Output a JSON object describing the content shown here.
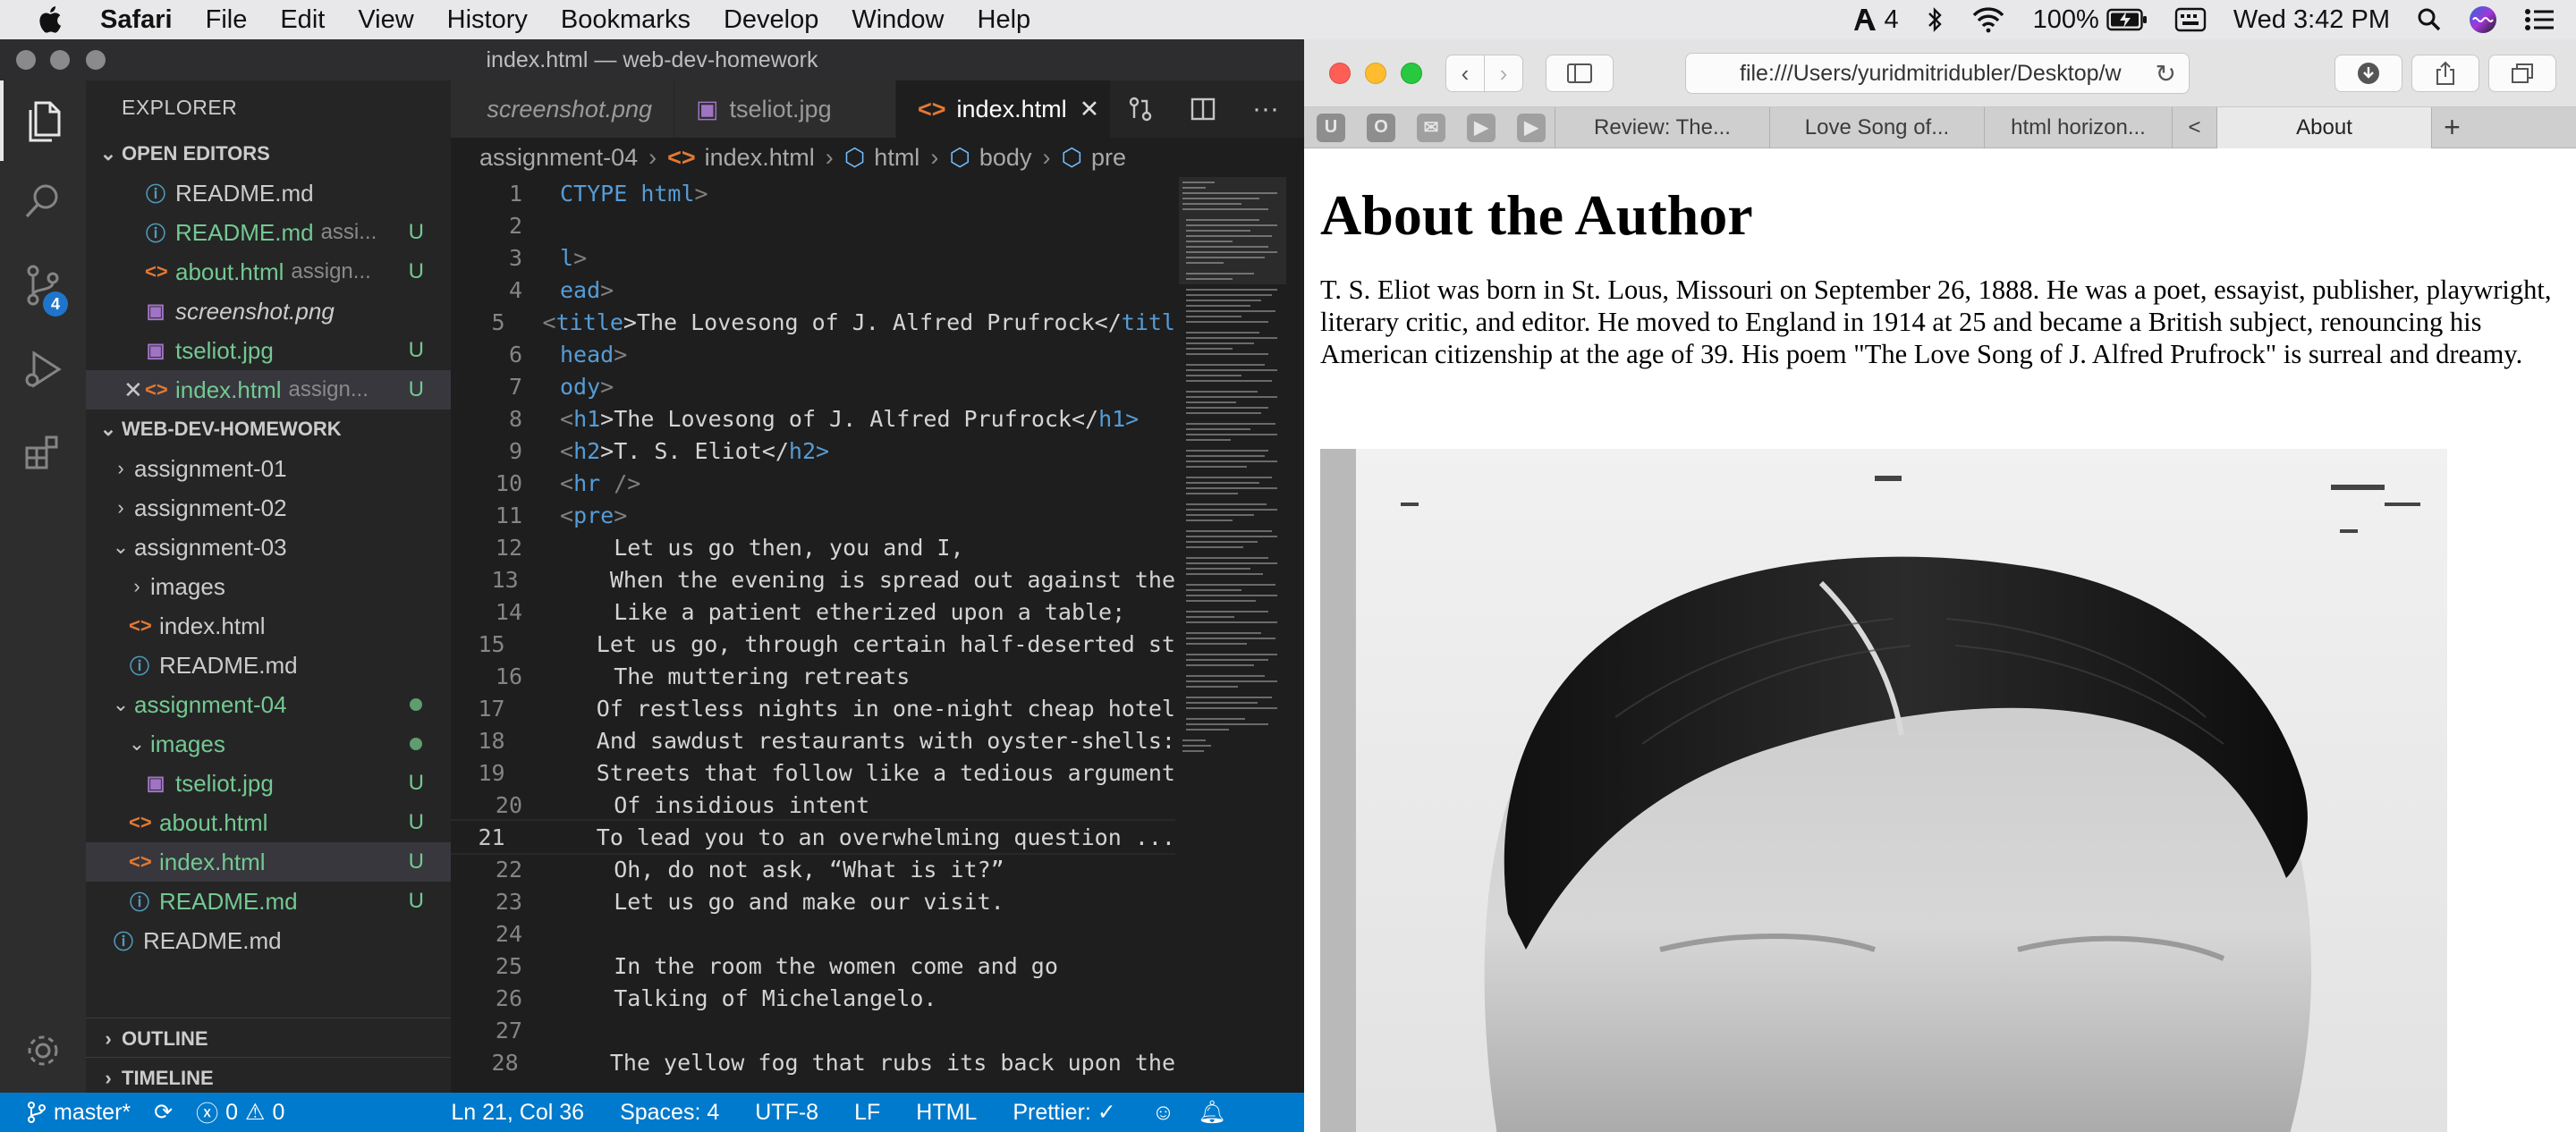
{
  "menubar": {
    "app": "Safari",
    "items": [
      "File",
      "Edit",
      "View",
      "History",
      "Bookmarks",
      "Develop",
      "Window",
      "Help"
    ],
    "adobe_count": "4",
    "battery": "100%",
    "clock": "Wed 3:42 PM"
  },
  "vscode": {
    "title": "index.html — web-dev-homework",
    "scm_badge": "4",
    "explorer": {
      "header": "EXPLORER",
      "open_editors_label": "OPEN EDITORS",
      "open_editors": [
        {
          "name": "README.md",
          "hint": "",
          "decoration": ""
        },
        {
          "name": "README.md",
          "hint": "assi...",
          "decoration": "U"
        },
        {
          "name": "about.html",
          "hint": "assign...",
          "decoration": "U"
        },
        {
          "name": "screenshot.png",
          "hint": "",
          "decoration": ""
        },
        {
          "name": "tseliot.jpg",
          "hint": "",
          "decoration": "U"
        },
        {
          "name": "index.html",
          "hint": "assign...",
          "decoration": "U"
        }
      ],
      "workspace_label": "WEB-DEV-HOMEWORK",
      "tree": {
        "a1": "assignment-01",
        "a2": "assignment-02",
        "a3": "assignment-03",
        "a3_images": "images",
        "a3_index": "index.html",
        "a3_readme": "README.md",
        "a4": "assignment-04",
        "a4_images": "images",
        "a4_tseliot": "tseliot.jpg",
        "a4_about": "about.html",
        "a4_index": "index.html",
        "a4_readme": "README.md",
        "root_readme": "README.md",
        "u": "U"
      },
      "outline_label": "OUTLINE",
      "timeline_label": "TIMELINE"
    },
    "tabs": [
      "screenshot.png",
      "tseliot.jpg",
      "index.html"
    ],
    "breadcrumbs": [
      "assignment-04",
      "index.html",
      "html",
      "body",
      "pre"
    ],
    "code_lines": [
      {
        "n": "1",
        "a": "",
        "b": "CTYPE ",
        "c": "html",
        "d": ">"
      },
      {
        "n": "2",
        "a": "",
        "b": "",
        "c": "",
        "d": ""
      },
      {
        "n": "3",
        "a": "",
        "b": "l",
        "c": "",
        "d": ">"
      },
      {
        "n": "4",
        "a": "",
        "b": "ead",
        "c": "",
        "d": ">"
      },
      {
        "n": "5",
        "a": "<",
        "b": "title",
        "c": ">The Lovesong of J. Alfred Prufrock</",
        "d": "titl"
      },
      {
        "n": "6",
        "a": "",
        "b": "head",
        "c": "",
        "d": ">"
      },
      {
        "n": "7",
        "a": "",
        "b": "ody",
        "c": "",
        "d": ">"
      },
      {
        "n": "8",
        "a": "<",
        "b": "h1",
        "c": ">The Lovesong of J. Alfred Prufrock</",
        "d": "h1>"
      },
      {
        "n": "9",
        "a": "<",
        "b": "h2",
        "c": ">T. S. Eliot</",
        "d": "h2>"
      },
      {
        "n": "10",
        "a": "<",
        "b": "hr",
        "c": " /",
        "d": ">"
      },
      {
        "n": "11",
        "a": "<",
        "b": "pre",
        "c": "",
        "d": ">"
      },
      {
        "n": "12",
        "a": "",
        "b": "",
        "c": "    Let us go then, you and I,",
        "d": ""
      },
      {
        "n": "13",
        "a": "",
        "b": "",
        "c": "    When the evening is spread out against the",
        "d": ""
      },
      {
        "n": "14",
        "a": "",
        "b": "",
        "c": "    Like a patient etherized upon a table;",
        "d": ""
      },
      {
        "n": "15",
        "a": "",
        "b": "",
        "c": "    Let us go, through certain half-deserted st",
        "d": ""
      },
      {
        "n": "16",
        "a": "",
        "b": "",
        "c": "    The muttering retreats",
        "d": ""
      },
      {
        "n": "17",
        "a": "",
        "b": "",
        "c": "    Of restless nights in one-night cheap hotel",
        "d": ""
      },
      {
        "n": "18",
        "a": "",
        "b": "",
        "c": "    And sawdust restaurants with oyster-shells:",
        "d": ""
      },
      {
        "n": "19",
        "a": "",
        "b": "",
        "c": "    Streets that follow like a tedious argument",
        "d": ""
      },
      {
        "n": "20",
        "a": "",
        "b": "",
        "c": "    Of insidious intent",
        "d": ""
      },
      {
        "n": "21",
        "a": "",
        "b": "",
        "c": "    To lead you to an overwhelming question ...",
        "d": ""
      },
      {
        "n": "22",
        "a": "",
        "b": "",
        "c": "    Oh, do not ask, “What is it?”",
        "d": ""
      },
      {
        "n": "23",
        "a": "",
        "b": "",
        "c": "    Let us go and make our visit.",
        "d": ""
      },
      {
        "n": "24",
        "a": "",
        "b": "",
        "c": "",
        "d": ""
      },
      {
        "n": "25",
        "a": "",
        "b": "",
        "c": "    In the room the women come and go",
        "d": ""
      },
      {
        "n": "26",
        "a": "",
        "b": "",
        "c": "    Talking of Michelangelo.",
        "d": ""
      },
      {
        "n": "27",
        "a": "",
        "b": "",
        "c": "",
        "d": ""
      },
      {
        "n": "28",
        "a": "",
        "b": "",
        "c": "    The yellow fog that rubs its back upon the",
        "d": ""
      }
    ],
    "status": {
      "branch": "master*",
      "errors": "0",
      "warnings": "0",
      "position": "Ln 21, Col 36",
      "spaces": "Spaces: 4",
      "encoding": "UTF-8",
      "eol": "LF",
      "language": "HTML",
      "prettier": "Prettier: ✓"
    }
  },
  "safari": {
    "url": "file:///Users/yuridmitridubler/Desktop/w",
    "favorites": [
      "U",
      "O"
    ],
    "tabs": [
      "Review: The...",
      "Love Song of...",
      "html horizon...",
      "<",
      "About"
    ],
    "page": {
      "heading": "About the Author",
      "paragraph": "T. S. Eliot was born in St. Lous, Missouri on September 26, 1888. He was a poet, essayist, publisher, playwright, literary critic, and editor. He moved to England in 1914 at 25 and became a British subject, renouncing his American citizenship at the age of 39. His poem \"The Love Song of J. Alfred Prufrock\" is surreal and dreamy."
    }
  },
  "colors": {
    "statusbar": "#007acc",
    "editor_bg": "#1e1e1e",
    "sidebar_bg": "#252526",
    "untracked": "#73c991",
    "tag": "#569cd6"
  }
}
